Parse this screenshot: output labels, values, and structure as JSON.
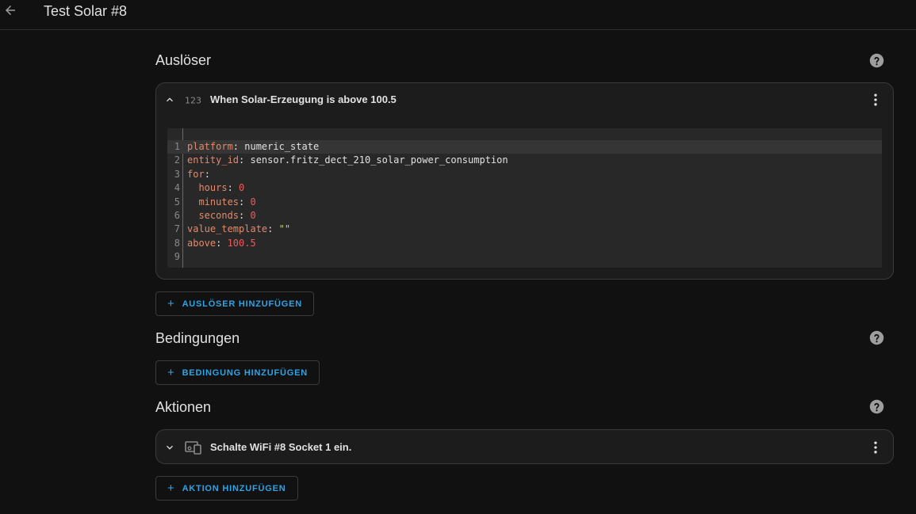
{
  "header": {
    "title": "Test Solar #8"
  },
  "triggers": {
    "section_title": "Auslöser",
    "card": {
      "type_icon": "numeric-123-icon",
      "label": "When Solar-Erzeugung is above 100.5",
      "expanded": true,
      "yaml_lines": [
        {
          "num": "1",
          "key": "platform",
          "sep": ": ",
          "value": "numeric_state",
          "vtype": "s"
        },
        {
          "num": "2",
          "key": "entity_id",
          "sep": ": ",
          "value": "sensor.fritz_dect_210_solar_power_consumption",
          "vtype": "s"
        },
        {
          "num": "3",
          "key": "for",
          "sep": ":",
          "value": "",
          "vtype": "s"
        },
        {
          "num": "4",
          "key": "  hours",
          "sep": ": ",
          "value": "0",
          "vtype": "n"
        },
        {
          "num": "5",
          "key": "  minutes",
          "sep": ": ",
          "value": "0",
          "vtype": "n"
        },
        {
          "num": "6",
          "key": "  seconds",
          "sep": ": ",
          "value": "0",
          "vtype": "n"
        },
        {
          "num": "7",
          "key": "value_template",
          "sep": ": ",
          "value": "\"\"",
          "vtype": "q"
        },
        {
          "num": "8",
          "key": "above",
          "sep": ": ",
          "value": "100.5",
          "vtype": "n"
        },
        {
          "num": "9",
          "key": "",
          "sep": "",
          "value": "",
          "vtype": "s"
        }
      ]
    },
    "add_label": "AUSLÖSER HINZUFÜGEN"
  },
  "conditions": {
    "section_title": "Bedingungen",
    "add_label": "BEDINGUNG HINZUFÜGEN"
  },
  "actions": {
    "section_title": "Aktionen",
    "card": {
      "type_icon": "devices-icon",
      "label": "Schalte WiFi #8 Socket 1 ein.",
      "expanded": false
    },
    "add_label": "AKTION HINZUFÜGEN"
  },
  "colors": {
    "accent": "#2ea3e6",
    "background": "#111111",
    "card": "#1c1c1c",
    "editor": "#282828",
    "yaml_key": "#e38a6b",
    "yaml_number": "#f05a5a",
    "yaml_string": "#c8d07a"
  }
}
